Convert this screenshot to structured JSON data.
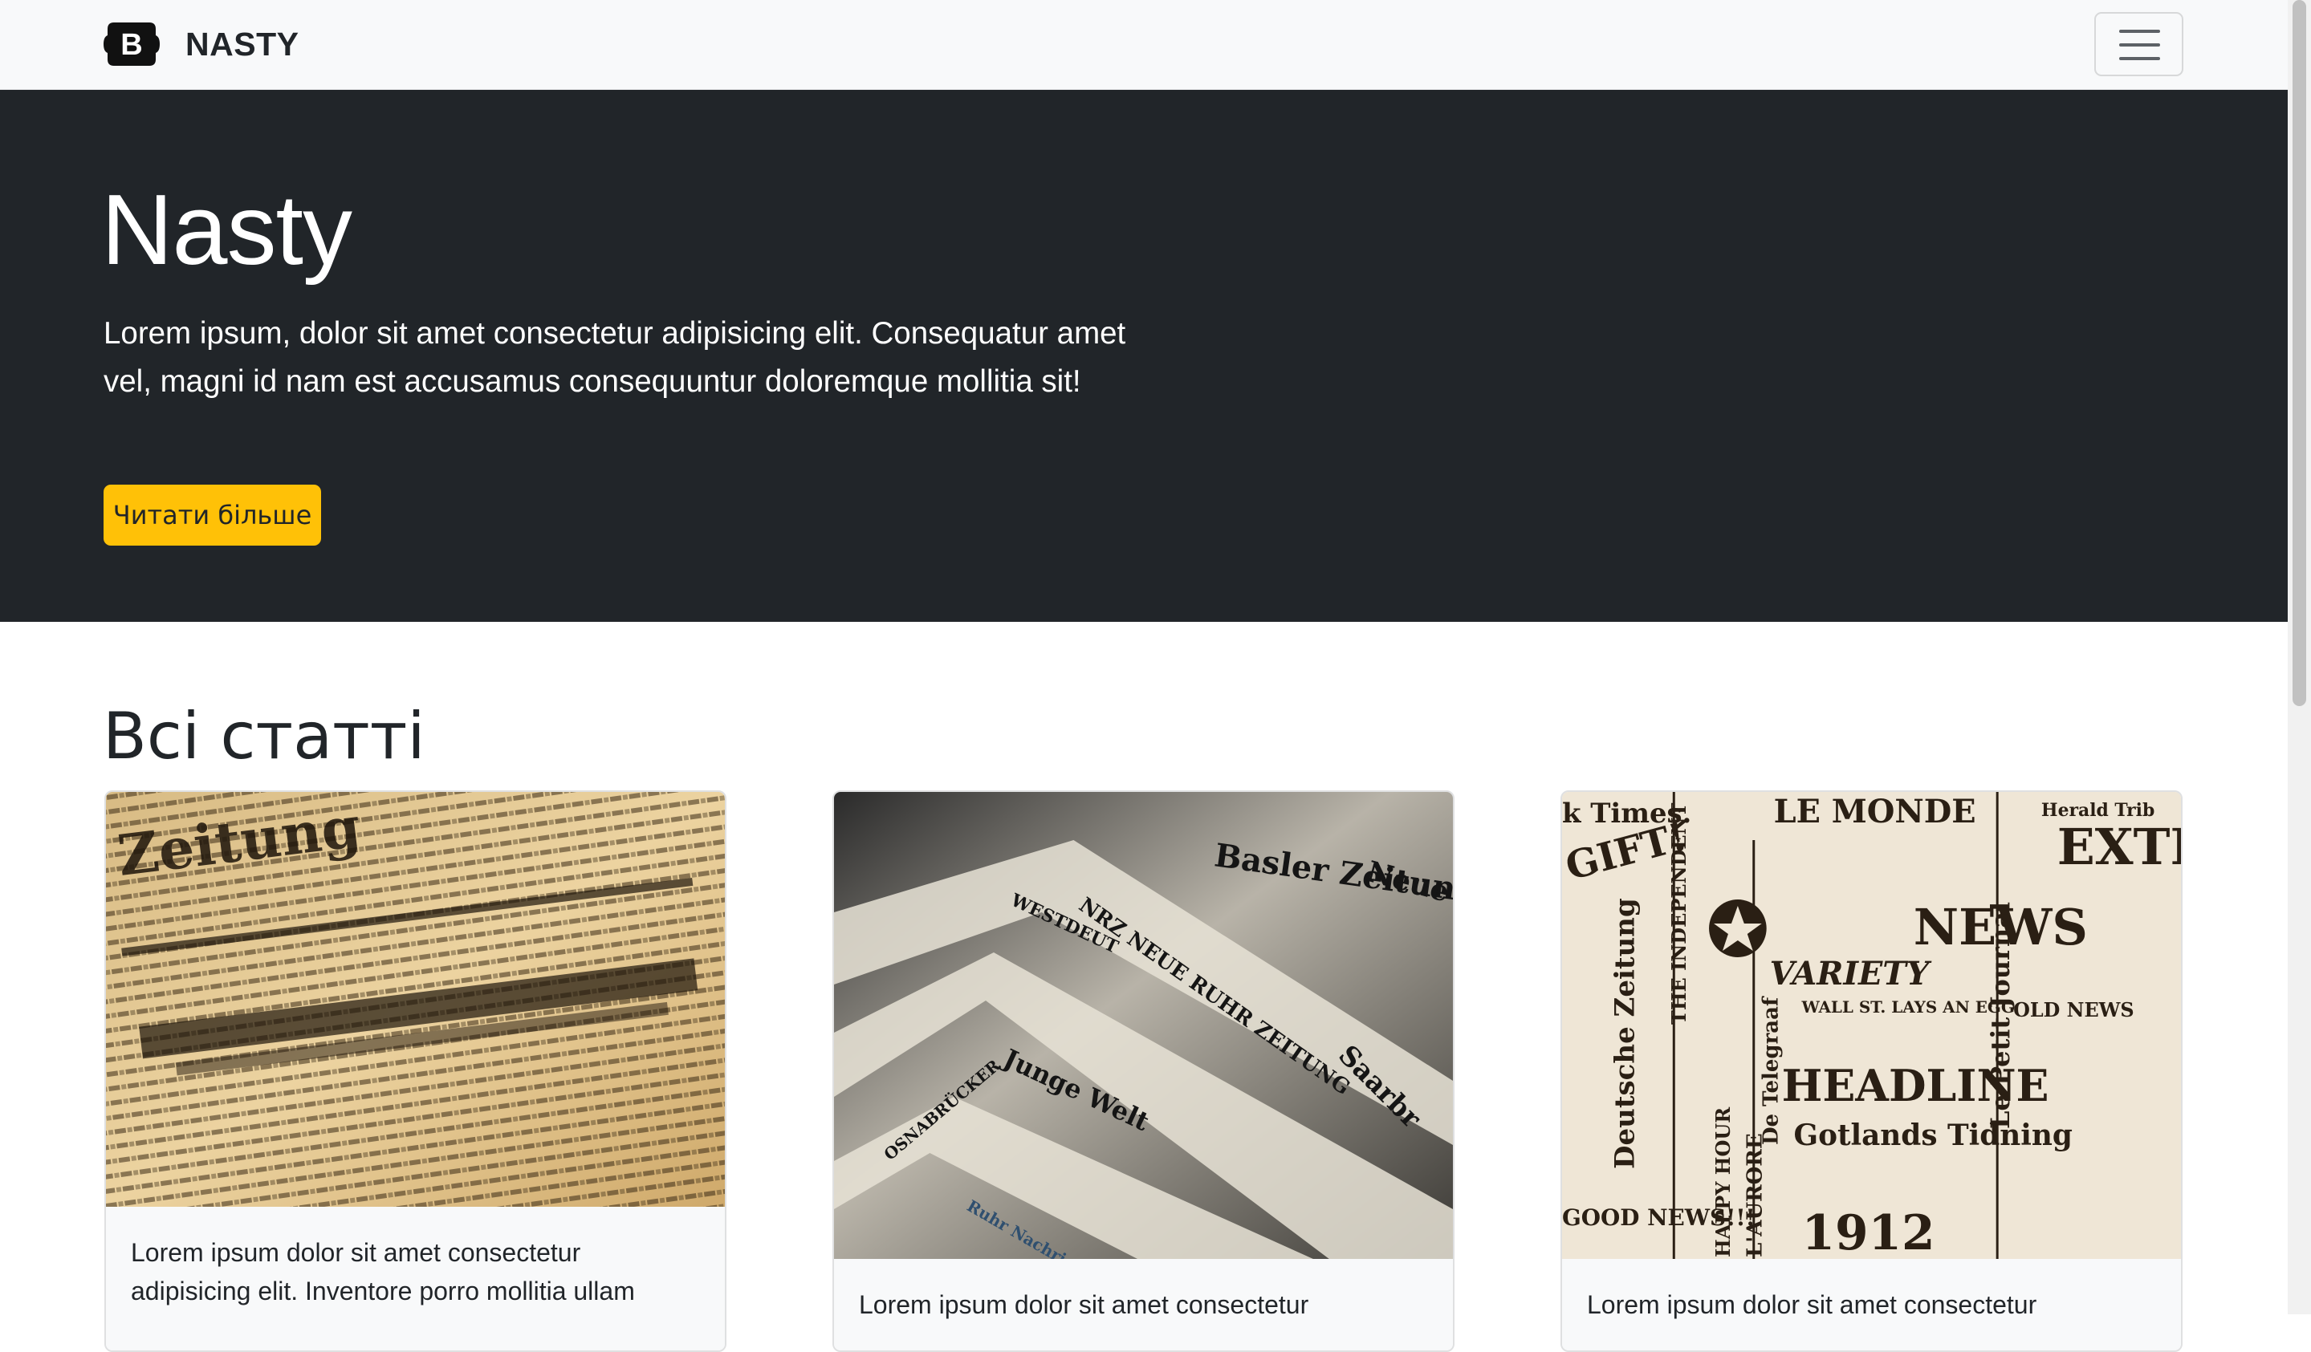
{
  "navbar": {
    "brand_letter": "B",
    "brand_text": "NASTY",
    "toggler_icon": "hamburger-icon"
  },
  "hero": {
    "title": "Nasty",
    "lead": "Lorem ipsum, dolor sit amet consectetur adipisicing elit. Consequatur amet vel, magni id nam est accusamus consequuntur doloremque mollitia sit!",
    "button_label": "Читати більше"
  },
  "articles": {
    "title": "Всі статті",
    "cards": [
      {
        "text": "Lorem ipsum dolor sit amet consectetur adipisicing elit. Inventore porro mollitia ullam",
        "image_logos": [
          "Zeitung"
        ]
      },
      {
        "text": "Lorem ipsum dolor sit amet consectetur",
        "image_logos": [
          "Basler Zeitung",
          "WESTDEUT",
          "NRZ NEUE RUHR ZEITUNG",
          "Junge Welt",
          "OSNABRÜCKER",
          "Saarbr",
          "Ruhr Nachrichten",
          "Neue"
        ]
      },
      {
        "text": "Lorem ipsum dolor sit amet consectetur",
        "image_logos": [
          "k Times.",
          "LE MONDE",
          "Herald Trib",
          "GIFT!",
          "EXTRA",
          "NEWS",
          "THE INDEPENDENT",
          "VARIETY",
          "WALL ST. LAYS AN EGG",
          "OLD NEWS",
          "HEADLINE",
          "Gotlands Tidning",
          "Deutsche Zeitung",
          "HAPPY HOUR",
          "GOOD NEWS!!!",
          "1912",
          "Le Petit Journal",
          "L'AURORE",
          "De Telegraaf"
        ]
      }
    ]
  },
  "colors": {
    "navbar_bg": "#f8f9fa",
    "hero_bg": "#212529",
    "accent_button": "#ffc107"
  }
}
